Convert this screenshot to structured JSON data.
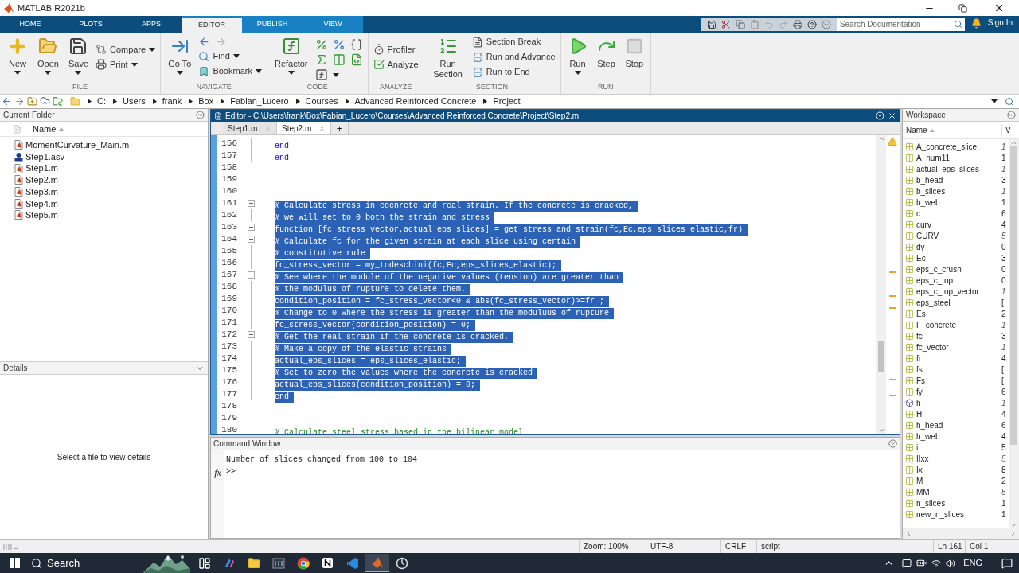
{
  "window": {
    "title": "MATLAB R2021b"
  },
  "tabs": [
    {
      "label": "HOME",
      "selected": false,
      "contextual": false
    },
    {
      "label": "PLOTS",
      "selected": false,
      "contextual": false
    },
    {
      "label": "APPS",
      "selected": false,
      "contextual": false
    },
    {
      "label": "EDITOR",
      "selected": true,
      "contextual": true
    },
    {
      "label": "PUBLISH",
      "selected": false,
      "contextual": true
    },
    {
      "label": "VIEW",
      "selected": false,
      "contextual": true
    }
  ],
  "search": {
    "placeholder": "Search Documentation"
  },
  "sign_in": "Sign In",
  "toolstrip": [
    {
      "label": "FILE",
      "items": [
        {
          "label": "New",
          "kind": "large",
          "caret": true
        },
        {
          "label": "Open",
          "kind": "large",
          "caret": true
        },
        {
          "label": "Save",
          "kind": "large",
          "caret": true
        },
        {
          "label": "Compare",
          "kind": "small",
          "caret": true
        },
        {
          "label": "Print",
          "kind": "small",
          "caret": true
        }
      ]
    },
    {
      "label": "NAVIGATE",
      "items": [
        {
          "label": "Go To",
          "kind": "large",
          "caret": true
        },
        {
          "kind": "arrows"
        },
        {
          "label": "Find",
          "kind": "small",
          "caret": true
        },
        {
          "label": "Bookmark",
          "kind": "small",
          "caret": true
        }
      ]
    },
    {
      "label": "CODE",
      "items": [
        {
          "label": "Refactor",
          "kind": "large",
          "caret": true
        },
        {
          "kind": "grid"
        }
      ]
    },
    {
      "label": "ANALYZE",
      "items": [
        {
          "label": "Profiler",
          "kind": "small",
          "caret": false
        },
        {
          "label": "Analyze",
          "kind": "small",
          "caret": false
        }
      ]
    },
    {
      "label": "SECTION",
      "items": [
        {
          "label": "Run Section",
          "kind": "large",
          "caret": false
        },
        {
          "label": "Section Break",
          "kind": "small",
          "caret": false
        },
        {
          "label": "Run and Advance",
          "kind": "small",
          "caret": false
        },
        {
          "label": "Run to End",
          "kind": "small",
          "caret": false
        }
      ]
    },
    {
      "label": "RUN",
      "items": [
        {
          "label": "Run",
          "kind": "large",
          "caret": true
        },
        {
          "label": "Step",
          "kind": "large",
          "caret": false
        },
        {
          "label": "Stop",
          "kind": "large",
          "caret": false
        }
      ]
    }
  ],
  "address_bar": [
    "C:",
    "Users",
    "frank",
    "Box",
    "Fabian_Lucero",
    "Courses",
    "Advanced Reinforced Concrete",
    "Project"
  ],
  "current_folder": {
    "title": "Current Folder",
    "column": "Name",
    "files": [
      {
        "name": "MomentCurvature_Main.m",
        "kind": "m"
      },
      {
        "name": "Step1.asv",
        "kind": "asv"
      },
      {
        "name": "Step1.m",
        "kind": "m"
      },
      {
        "name": "Step2.m",
        "kind": "m"
      },
      {
        "name": "Step3.m",
        "kind": "m"
      },
      {
        "name": "Step4.m",
        "kind": "m"
      },
      {
        "name": "Step5.m",
        "kind": "m"
      }
    ]
  },
  "details": {
    "title": "Details",
    "message": "Select a file to view details"
  },
  "editor": {
    "title": "Editor - C:\\Users\\frank\\Box\\Fabian_Lucero\\Courses\\Advanced Reinforced Concrete\\Project\\Step2.m",
    "tabs": [
      {
        "label": "Step1.m",
        "selected": false
      },
      {
        "label": "Step2.m",
        "selected": true
      }
    ],
    "new_tab": "+",
    "lines": [
      {
        "number": "156",
        "text": "end",
        "kind": "keyword",
        "selected": false,
        "fold_toggle": false
      },
      {
        "number": "157",
        "text": "end",
        "kind": "keyword",
        "selected": false,
        "fold_toggle": false
      },
      {
        "number": "158",
        "selected": false
      },
      {
        "number": "159",
        "selected": false
      },
      {
        "number": "160",
        "selected": false
      },
      {
        "number": "161",
        "text": "% Calculate stress in cocnrete and real strain. If the concrete is cracked,",
        "selected": true,
        "fold_toggle": true
      },
      {
        "number": "162",
        "text": "% we will set to 0 both the strain and stress",
        "selected": true,
        "fold_toggle": false
      },
      {
        "number": "163",
        "text": "function [fc_stress_vector,actual_eps_slices] = get_stress_and_strain(fc,Ec,eps_slices_elastic,fr)",
        "selected": true,
        "fold_toggle": true
      },
      {
        "number": "164",
        "text": "% Calculate fc for the given strain at each slice using certain",
        "selected": true,
        "fold_toggle": true
      },
      {
        "number": "165",
        "text": "% constitutive rule",
        "selected": true,
        "fold_toggle": false
      },
      {
        "number": "166",
        "text": "fc_stress_vector = my_todeschini(fc,Ec,eps_slices_elastic);",
        "selected": true,
        "fold_toggle": false
      },
      {
        "number": "167",
        "text": "% See where the module of the negative values (tension) are greater than",
        "selected": true,
        "fold_toggle": true
      },
      {
        "number": "168",
        "text": "% the modulus of rupture to delete them.",
        "selected": true,
        "fold_toggle": false
      },
      {
        "number": "169",
        "text": "condition_position = fc_stress_vector<0 & abs(fc_stress_vector)>=fr ;",
        "selected": true,
        "fold_toggle": false
      },
      {
        "number": "170",
        "text": "% Change to 0 where the stress is greater than the moduluus of rupture",
        "selected": true,
        "fold_toggle": false
      },
      {
        "number": "171",
        "text": "fc_stress_vector(condition_position) = 0;",
        "selected": true,
        "fold_toggle": false
      },
      {
        "number": "172",
        "text": "% Get the real strain if the concrete is cracked.",
        "selected": true,
        "fold_toggle": true
      },
      {
        "number": "173",
        "text": "% Make a copy of the elastic strains",
        "selected": true,
        "fold_toggle": false
      },
      {
        "number": "174",
        "text": "actual_eps_slices = eps_slices_elastic;",
        "selected": true,
        "fold_toggle": false
      },
      {
        "number": "175",
        "text": "% Set to zero the values where the concrete is cracked",
        "selected": true,
        "fold_toggle": false
      },
      {
        "number": "176",
        "text": "actual_eps_slices(condition_position) = 0;",
        "selected": true,
        "fold_toggle": false
      },
      {
        "number": "177",
        "text": "end",
        "selected": true,
        "fold_toggle": false
      },
      {
        "number": "178",
        "selected": false
      },
      {
        "number": "179",
        "selected": false
      },
      {
        "number": "180",
        "text": "% Calculate steel stress based in the bilinear model",
        "kind": "comment",
        "selected": false
      }
    ]
  },
  "command_window": {
    "title": "Command Window",
    "output": "Number of slices changed from 100 to 104",
    "function_button": "fx",
    "prompt": ">>"
  },
  "workspace": {
    "title": "Workspace",
    "column_1": "Name",
    "column_2": "V",
    "variables": [
      {
        "name": "A_concrete_slice",
        "value": "1",
        "italic": true,
        "kind": "matrix"
      },
      {
        "name": "A_num11",
        "value": "1",
        "italic": false,
        "kind": "matrix"
      },
      {
        "name": "actual_eps_slices",
        "value": "1",
        "italic": true,
        "kind": "matrix"
      },
      {
        "name": "b_head",
        "value": "3",
        "italic": false,
        "kind": "matrix"
      },
      {
        "name": "b_slices",
        "value": "1",
        "italic": true,
        "kind": "matrix"
      },
      {
        "name": "b_web",
        "value": "1",
        "italic": false,
        "kind": "matrix"
      },
      {
        "name": "c",
        "value": "6",
        "italic": false,
        "kind": "matrix"
      },
      {
        "name": "curv",
        "value": "4",
        "italic": false,
        "kind": "matrix"
      },
      {
        "name": "CURV",
        "value": "5",
        "italic": true,
        "kind": "matrix"
      },
      {
        "name": "dy",
        "value": "0",
        "italic": false,
        "kind": "matrix"
      },
      {
        "name": "Ec",
        "value": "3",
        "italic": false,
        "kind": "matrix"
      },
      {
        "name": "eps_c_crush",
        "value": "0",
        "italic": false,
        "kind": "matrix"
      },
      {
        "name": "eps_c_top",
        "value": "0",
        "italic": false,
        "kind": "matrix"
      },
      {
        "name": "eps_c_top_vector",
        "value": "1",
        "italic": true,
        "kind": "matrix"
      },
      {
        "name": "eps_steel",
        "value": "[",
        "italic": false,
        "kind": "matrix"
      },
      {
        "name": "Es",
        "value": "2",
        "italic": false,
        "kind": "matrix"
      },
      {
        "name": "F_concrete",
        "value": "1",
        "italic": true,
        "kind": "matrix"
      },
      {
        "name": "fc",
        "value": "3",
        "italic": false,
        "kind": "matrix"
      },
      {
        "name": "fc_vector",
        "value": "1",
        "italic": true,
        "kind": "matrix"
      },
      {
        "name": "fr",
        "value": "4",
        "italic": false,
        "kind": "matrix"
      },
      {
        "name": "fs",
        "value": "[",
        "italic": false,
        "kind": "matrix"
      },
      {
        "name": "Fs",
        "value": "[",
        "italic": false,
        "kind": "matrix"
      },
      {
        "name": "fy",
        "value": "6",
        "italic": false,
        "kind": "matrix"
      },
      {
        "name": "h",
        "value": "1",
        "italic": true,
        "kind": "object"
      },
      {
        "name": "H",
        "value": "4",
        "italic": false,
        "kind": "matrix"
      },
      {
        "name": "h_head",
        "value": "6",
        "italic": false,
        "kind": "matrix"
      },
      {
        "name": "h_web",
        "value": "4",
        "italic": false,
        "kind": "matrix"
      },
      {
        "name": "i",
        "value": "5",
        "italic": false,
        "kind": "matrix"
      },
      {
        "name": "IIxx",
        "value": "5",
        "italic": true,
        "kind": "matrix"
      },
      {
        "name": "Ix",
        "value": "8",
        "italic": false,
        "kind": "matrix"
      },
      {
        "name": "M",
        "value": "2",
        "italic": false,
        "kind": "matrix"
      },
      {
        "name": "MM",
        "value": "5",
        "italic": true,
        "kind": "matrix"
      },
      {
        "name": "n_slices",
        "value": "1",
        "italic": false,
        "kind": "matrix"
      },
      {
        "name": "new_n_slices",
        "value": "1",
        "italic": false,
        "kind": "matrix"
      }
    ]
  },
  "status_bar": [
    "Zoom: 100%",
    "UTF-8",
    "CRLF",
    "script",
    "Ln 161",
    "Col 1"
  ],
  "taskbar": {
    "search": "Search",
    "language": "ENG",
    "apps": [
      {
        "selected": false
      },
      {
        "selected": false
      },
      {
        "selected": false
      },
      {
        "selected": false
      },
      {
        "selected": false
      },
      {
        "selected": false
      },
      {
        "selected": false
      },
      {
        "selected": true
      },
      {
        "selected": false
      }
    ]
  }
}
